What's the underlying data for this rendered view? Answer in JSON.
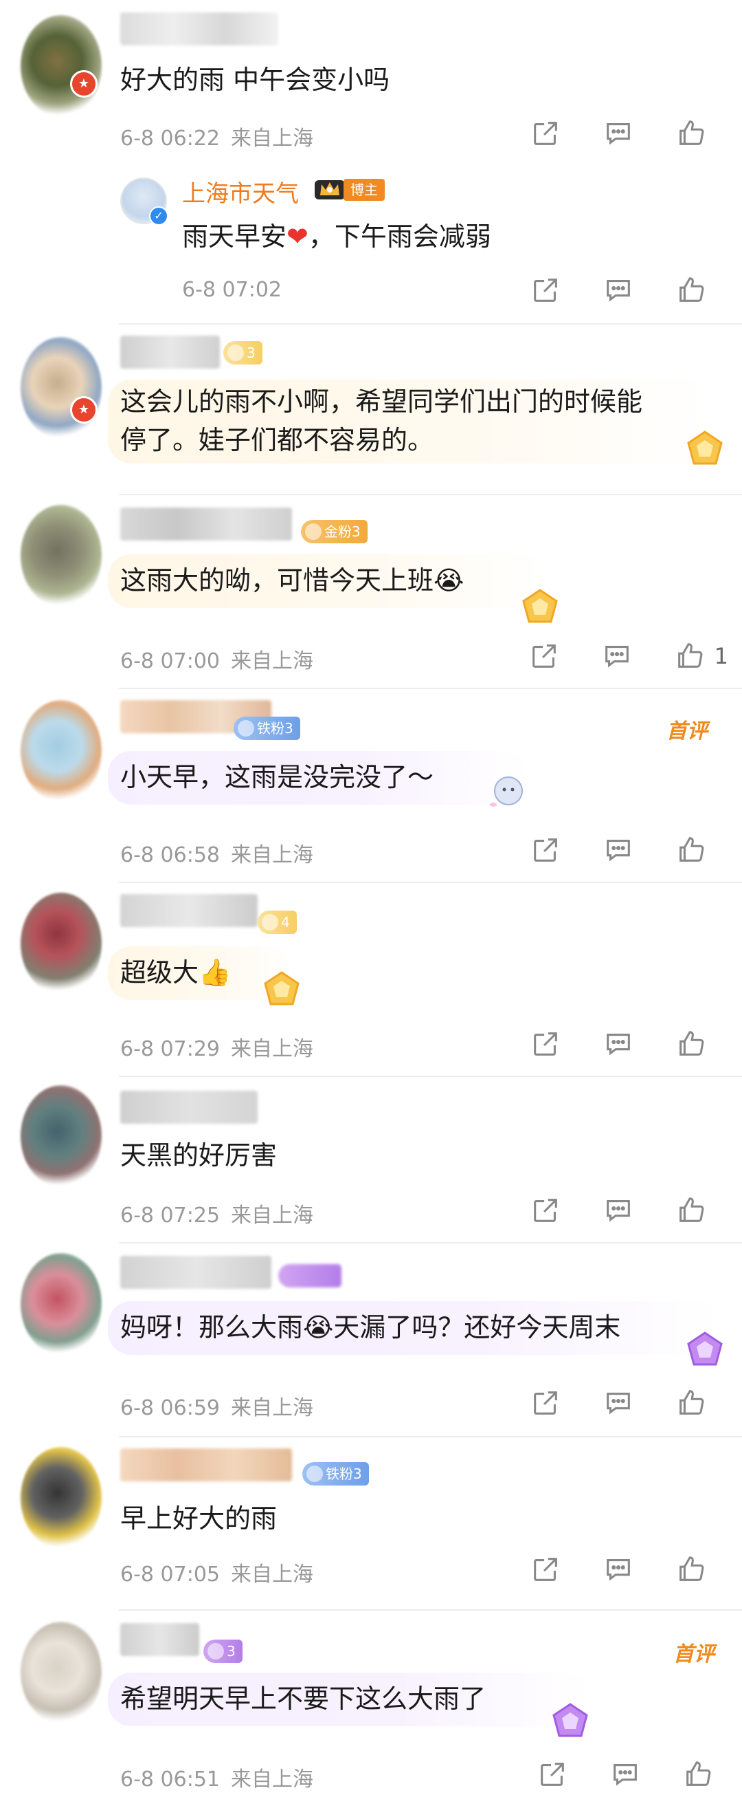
{
  "comments": [
    {
      "text": "好大的雨 中午会变小吗",
      "time": "6-8 06:22",
      "location": "来自上海",
      "reply": {
        "name": "上海市天气",
        "badge": "博主",
        "text_before": "雨天早安",
        "heart": "❤",
        "text_after": "，下午雨会减弱",
        "time": "6-8 07:02"
      }
    },
    {
      "fan_label": "3",
      "text": "这会儿的雨不小啊，希望同学们出门的时候能\n停了。娃子们都不容易的。"
    },
    {
      "fan_label": "金粉3",
      "text": "这雨大的呦，可惜今天上班😭",
      "time": "6-8 07:00",
      "location": "来自上海",
      "like_count": "1"
    },
    {
      "fan_label": "铁粉3",
      "first_badge": "首评",
      "text": "小天早，这雨是没完没了～",
      "time": "6-8 06:58",
      "location": "来自上海"
    },
    {
      "fan_label": "4",
      "text": "超级大👍",
      "time": "6-8 07:29",
      "location": "来自上海"
    },
    {
      "text": "天黑的好厉害",
      "time": "6-8 07:25",
      "location": "来自上海"
    },
    {
      "text": "妈呀！那么大雨😭天漏了吗？还好今天周末",
      "time": "6-8 06:59",
      "location": "来自上海"
    },
    {
      "fan_label": "铁粉3",
      "text": "早上好大的雨",
      "time": "6-8 07:05",
      "location": "来自上海"
    },
    {
      "fan_label": "3",
      "first_badge": "首评",
      "text": "希望明天早上不要下这么大雨了",
      "time": "6-8 06:51",
      "location": "来自上海"
    }
  ],
  "colors": {
    "accent_orange": "#f07b1c",
    "meta_gray": "#999999",
    "badge_red": "#e8452f"
  },
  "icons": [
    "share-icon",
    "comment-icon",
    "like-icon"
  ]
}
